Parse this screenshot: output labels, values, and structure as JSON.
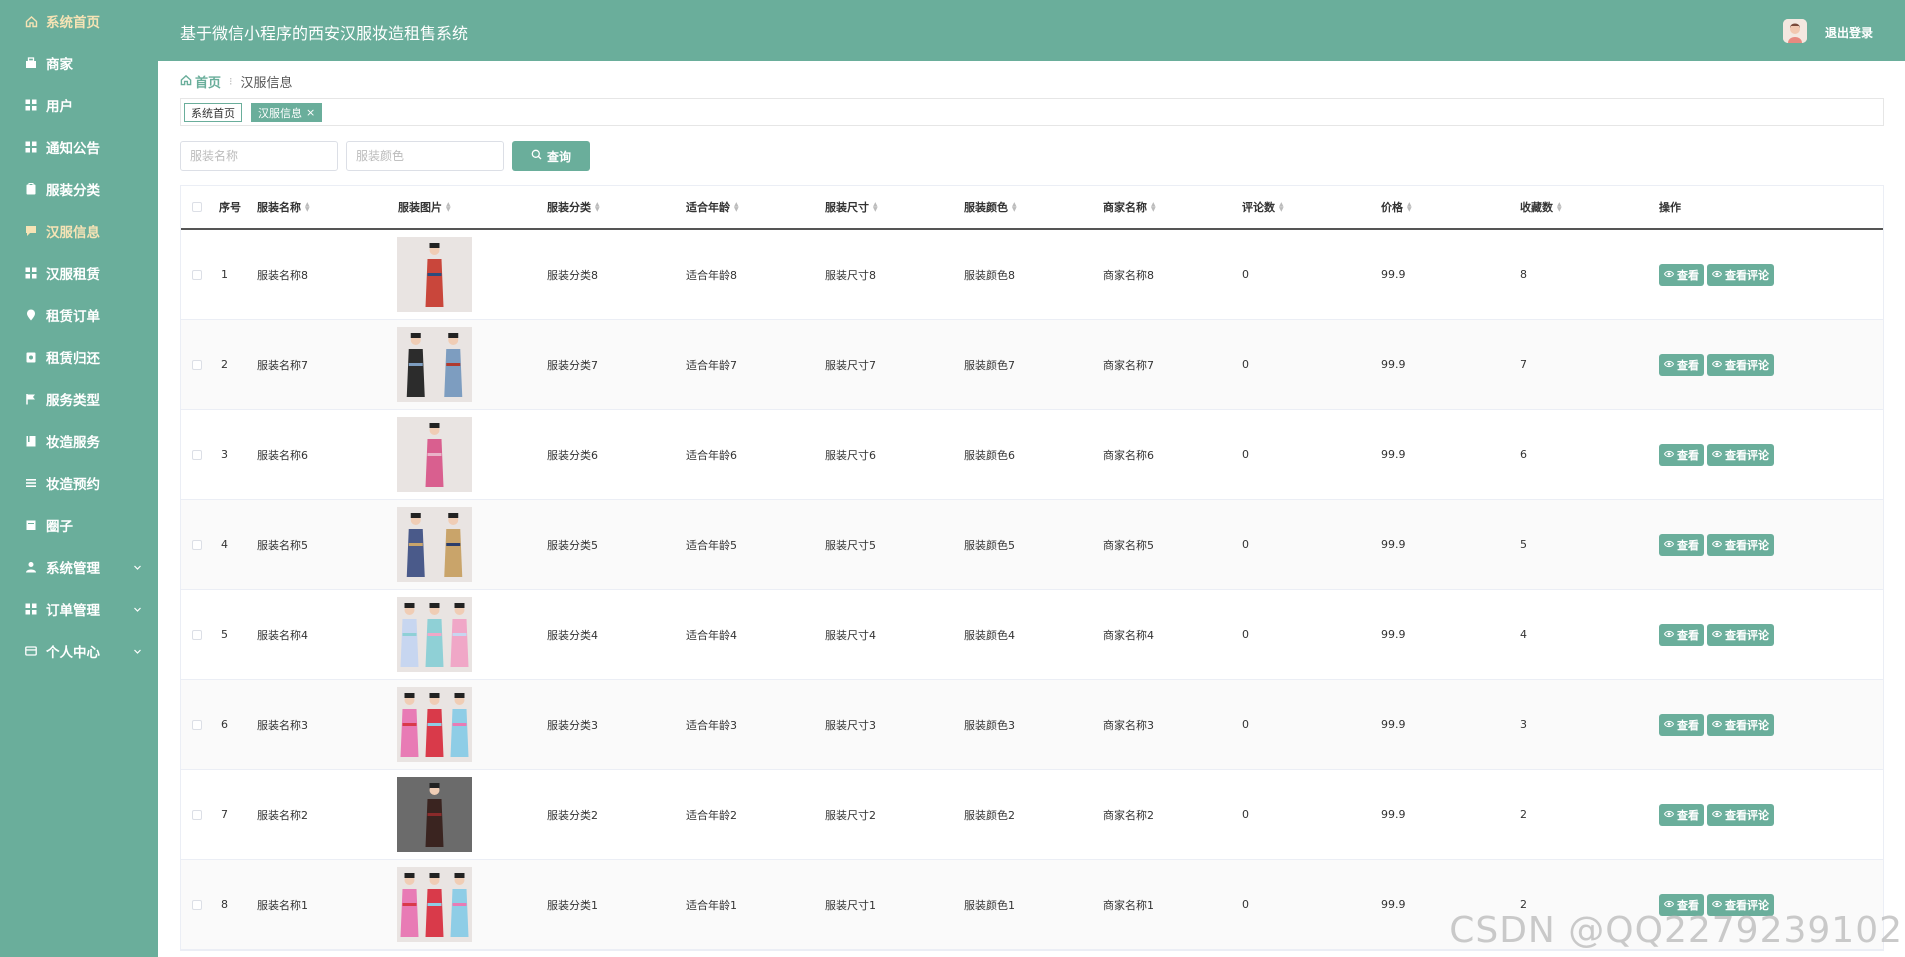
{
  "app": {
    "title": "基于微信小程序的西安汉服妆造租售系统",
    "logout": "退出登录",
    "accent_color": "#6aae9b",
    "active_menu_color": "#f6e3b5"
  },
  "sidebar": {
    "items": [
      {
        "label": "系统首页",
        "icon": "home-icon"
      },
      {
        "label": "商家",
        "icon": "shop-icon"
      },
      {
        "label": "用户",
        "icon": "grid-icon"
      },
      {
        "label": "通知公告",
        "icon": "grid-icon"
      },
      {
        "label": "服装分类",
        "icon": "clipboard-icon"
      },
      {
        "label": "汉服信息",
        "icon": "chat-icon"
      },
      {
        "label": "汉服租赁",
        "icon": "grid-icon"
      },
      {
        "label": "租赁订单",
        "icon": "pin-icon"
      },
      {
        "label": "租赁归还",
        "icon": "clipboard-icon"
      },
      {
        "label": "服务类型",
        "icon": "flag-icon"
      },
      {
        "label": "妆造服务",
        "icon": "book-icon"
      },
      {
        "label": "妆造预约",
        "icon": "list-icon"
      },
      {
        "label": "圈子",
        "icon": "note-icon"
      },
      {
        "label": "系统管理",
        "icon": "user-icon"
      },
      {
        "label": "订单管理",
        "icon": "grid-icon"
      },
      {
        "label": "个人中心",
        "icon": "card-icon"
      }
    ]
  },
  "breadcrumb": {
    "home": "首页",
    "current": "汉服信息"
  },
  "tags": {
    "tab1": "系统首页",
    "tab2": "汉服信息",
    "close": "×"
  },
  "search": {
    "name_placeholder": "服装名称",
    "color_placeholder": "服装颜色",
    "query_label": "查询"
  },
  "table": {
    "headers": {
      "index": "序号",
      "name": "服装名称",
      "image": "服装图片",
      "category": "服装分类",
      "age": "适合年龄",
      "size": "服装尺寸",
      "color": "服装颜色",
      "merchant": "商家名称",
      "comments": "评论数",
      "price": "价格",
      "favorites": "收藏数",
      "actions": "操作"
    },
    "view_label": "查看",
    "comments_label": "查看评论",
    "rows": [
      {
        "index": "1",
        "name": "服装名称8",
        "category": "服装分类8",
        "age": "适合年龄8",
        "size": "服装尺寸8",
        "color": "服装颜色8",
        "merchant": "商家名称8",
        "comments": "0",
        "price": "99.9",
        "favorites": "8"
      },
      {
        "index": "2",
        "name": "服装名称7",
        "category": "服装分类7",
        "age": "适合年龄7",
        "size": "服装尺寸7",
        "color": "服装颜色7",
        "merchant": "商家名称7",
        "comments": "0",
        "price": "99.9",
        "favorites": "7"
      },
      {
        "index": "3",
        "name": "服装名称6",
        "category": "服装分类6",
        "age": "适合年龄6",
        "size": "服装尺寸6",
        "color": "服装颜色6",
        "merchant": "商家名称6",
        "comments": "0",
        "price": "99.9",
        "favorites": "6"
      },
      {
        "index": "4",
        "name": "服装名称5",
        "category": "服装分类5",
        "age": "适合年龄5",
        "size": "服装尺寸5",
        "color": "服装颜色5",
        "merchant": "商家名称5",
        "comments": "0",
        "price": "99.9",
        "favorites": "5"
      },
      {
        "index": "5",
        "name": "服装名称4",
        "category": "服装分类4",
        "age": "适合年龄4",
        "size": "服装尺寸4",
        "color": "服装颜色4",
        "merchant": "商家名称4",
        "comments": "0",
        "price": "99.9",
        "favorites": "4"
      },
      {
        "index": "6",
        "name": "服装名称3",
        "category": "服装分类3",
        "age": "适合年龄3",
        "size": "服装尺寸3",
        "color": "服装颜色3",
        "merchant": "商家名称3",
        "comments": "0",
        "price": "99.9",
        "favorites": "3"
      },
      {
        "index": "7",
        "name": "服装名称2",
        "category": "服装分类2",
        "age": "适合年龄2",
        "size": "服装尺寸2",
        "color": "服装颜色2",
        "merchant": "商家名称2",
        "comments": "0",
        "price": "99.9",
        "favorites": "2"
      },
      {
        "index": "8",
        "name": "服装名称1",
        "category": "服装分类1",
        "age": "适合年龄1",
        "size": "服装尺寸1",
        "color": "服装颜色1",
        "merchant": "商家名称1",
        "comments": "0",
        "price": "99.9",
        "favorites": "2"
      }
    ]
  },
  "watermark": "CSDN @QQ2279239102"
}
